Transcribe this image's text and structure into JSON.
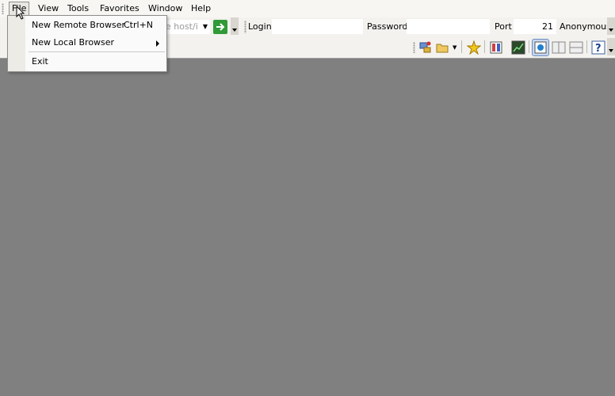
{
  "menubar": {
    "file": "File",
    "view": "View",
    "tools": "Tools",
    "favorites": "Favorites",
    "window": "Window",
    "help": "Help"
  },
  "file_menu": {
    "new_remote": "New Remote Browser",
    "new_remote_shortcut": "Ctrl+N",
    "new_local": "New Local Browser",
    "exit": "Exit"
  },
  "connection_bar": {
    "host_placeholder": "he host/i",
    "login_label": "Login",
    "password_label": "Password",
    "port_label": "Port",
    "port_value": "21",
    "anonymous_label": "Anonymous"
  },
  "colors": {
    "workspace": "#808080",
    "toolbar": "#f3f2ee",
    "go_button": "#2f9a37"
  }
}
